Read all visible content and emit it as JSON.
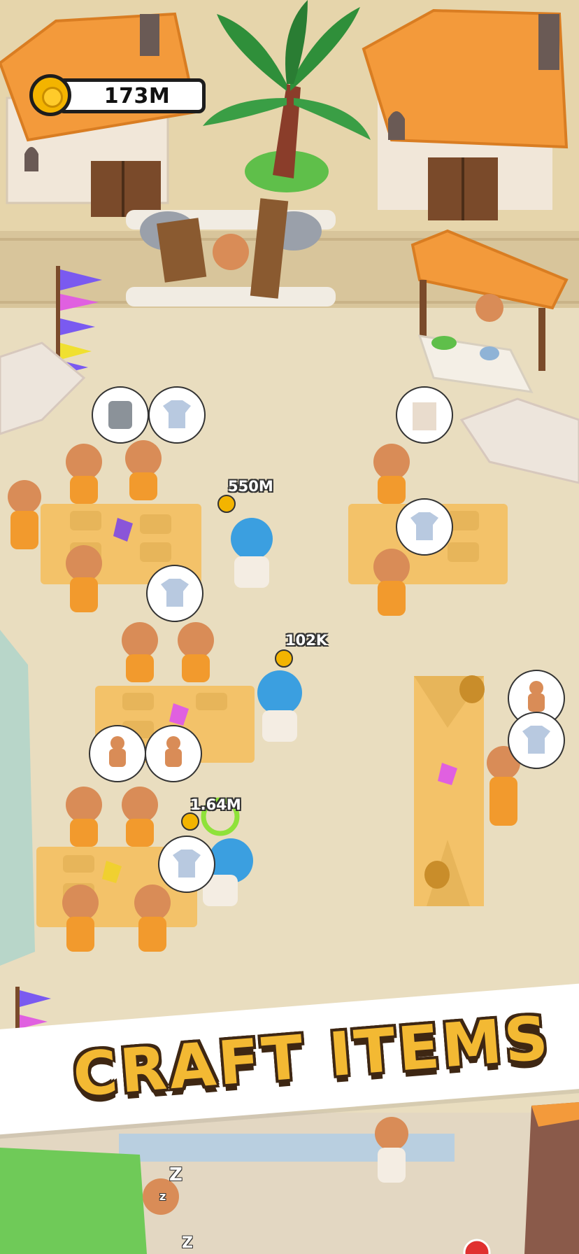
{
  "hud": {
    "coins": "173M"
  },
  "money_labels": [
    "550M",
    "102K",
    "1.64M"
  ],
  "banner": {
    "text": "CRAFT ITEMS"
  },
  "sleep_marks": [
    "Z",
    "z",
    "Z"
  ],
  "colors": {
    "ground": "#e9ddbf",
    "roof": "#f39a3b",
    "table": "#f3c269",
    "caveman_skin": "#d98c57",
    "outfit": "#f29a2d",
    "player_hair": "#3b9fe0",
    "banner_text": "#f3b933",
    "banner_outline": "#3e2713"
  },
  "icons": [
    "coin-icon",
    "stone-tablet-icon",
    "shirt-icon",
    "vest-icon",
    "gingerbread-figure-icon",
    "progress-ring-icon"
  ]
}
